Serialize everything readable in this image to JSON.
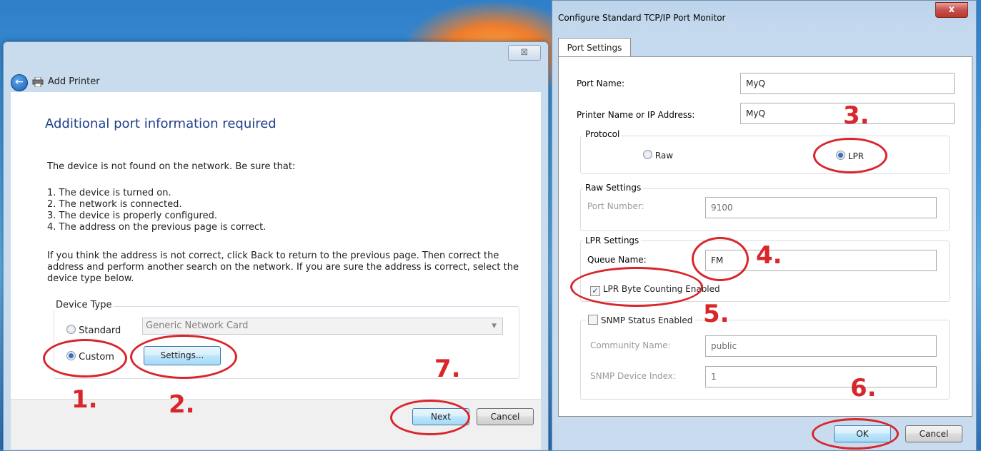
{
  "wizard": {
    "close_label": "⊠",
    "title": "Add Printer",
    "heading": "Additional port information required",
    "intro": "The device is not found on the network.  Be sure that:",
    "checklist": [
      "1.  The device is turned on.",
      "2.  The network is connected.",
      "3.  The device is properly configured.",
      "4.  The address on the previous page is correct."
    ],
    "advice": [
      "If you think the address is not correct, click Back to return to the previous page.  Then correct the",
      "address and perform another search on the network.  If you are sure the address is correct, select the",
      "device type below."
    ],
    "device_type_legend": "Device Type",
    "standard_label": "Standard",
    "standard_value": "Generic Network Card",
    "custom_label": "Custom",
    "selected": "Custom",
    "settings_button": "Settings...",
    "next_button": "Next",
    "cancel_button": "Cancel"
  },
  "tcp_dialog": {
    "title": "Configure Standard TCP/IP Port Monitor",
    "close_label": "x",
    "tab": "Port Settings",
    "port_name_label": "Port Name:",
    "port_name_value": "MyQ",
    "printer_name_label": "Printer Name or IP Address:",
    "printer_name_value": "MyQ",
    "protocol_legend": "Protocol",
    "raw_label": "Raw",
    "lpr_label": "LPR",
    "protocol_selected": "LPR",
    "raw_settings_legend": "Raw Settings",
    "port_number_label": "Port Number:",
    "port_number_value": "9100",
    "lpr_settings_legend": "LPR Settings",
    "queue_name_label": "Queue Name:",
    "queue_name_value": "FM",
    "byte_counting_label": "LPR Byte Counting Enabled",
    "byte_counting_checked": true,
    "snmp_label": "SNMP Status Enabled",
    "snmp_checked": false,
    "community_label": "Community Name:",
    "community_value": "public",
    "device_index_label": "SNMP Device Index:",
    "device_index_value": "1",
    "ok_button": "OK",
    "cancel_button": "Cancel"
  },
  "annotations": {
    "step1": "1.",
    "step2": "2.",
    "step3": "3.",
    "step4": "4.",
    "step5": "5.",
    "step6": "6.",
    "step7": "7.",
    "color": "#d8262b"
  },
  "icons": [
    "back-arrow-icon",
    "printer-icon",
    "close-icon",
    "dropdown-arrow-icon",
    "check-icon"
  ]
}
